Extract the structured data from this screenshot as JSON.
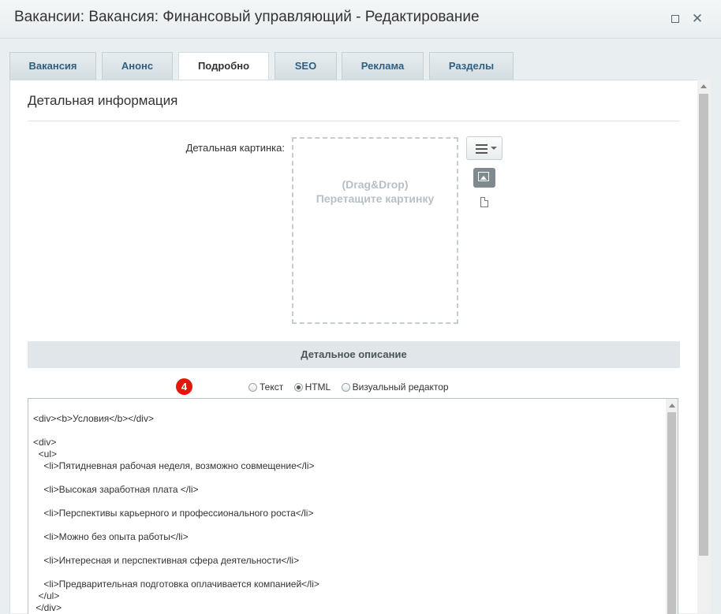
{
  "window": {
    "title": "Вакансии: Вакансия: Финансовый управляющий - Редактирование",
    "maximize_icon": "maximize-icon",
    "close_label": "✕"
  },
  "tabs": [
    {
      "label": "Вакансия",
      "active": false
    },
    {
      "label": "Анонс",
      "active": false
    },
    {
      "label": "Подробно",
      "active": true
    },
    {
      "label": "SEO",
      "active": false
    },
    {
      "label": "Реклама",
      "active": false
    },
    {
      "label": "Разделы",
      "active": false
    }
  ],
  "section": {
    "title": "Детальная информация",
    "image_label": "Детальная картинка:",
    "dropzone_line1": "(Drag&Drop)",
    "dropzone_line2": "Перетащите картинку",
    "description_header": "Детальное описание",
    "badge": "4"
  },
  "editor_modes": [
    {
      "label": "Текст",
      "checked": false
    },
    {
      "label": "HTML",
      "checked": true
    },
    {
      "label": "Визуальный редактор",
      "checked": false
    }
  ],
  "editor": {
    "code": "<div><b>Условия</b></div>\n\n<div>\n  <ul>\n    <li>Пятидневная рабочая неделя, возможно совмещение</li>\n\n    <li>Высокая заработная плата </li>\n\n    <li>Перспективы карьерного и профессионального роста</li>\n\n    <li>Можно без опыта работы</li>\n\n    <li>Интересная и перспективная сфера деятельности</li>\n\n    <li>Предварительная подготовка оплачивается компанией</li>\n  </ul>\n </div>"
  }
}
